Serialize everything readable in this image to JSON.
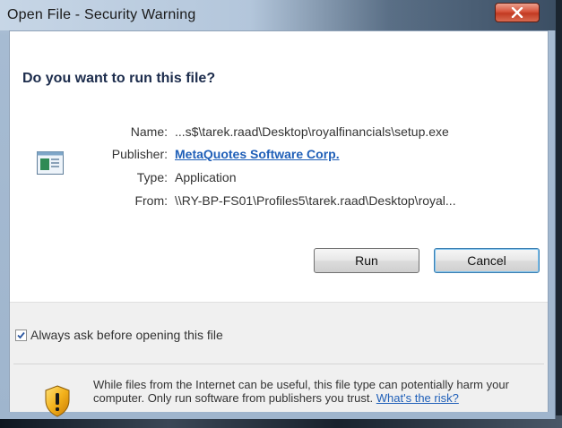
{
  "window": {
    "title": "Open File - Security Warning",
    "close_glyph": "X"
  },
  "dialog": {
    "heading": "Do you want to run this file?",
    "file_icon": "application-file-icon",
    "fields": {
      "name_label": "Name:",
      "name_value": "...s$\\tarek.raad\\Desktop\\royalfinancials\\setup.exe",
      "publisher_label": "Publisher:",
      "publisher_value": "MetaQuotes Software Corp.",
      "type_label": "Type:",
      "type_value": "Application",
      "from_label": "From:",
      "from_value": "\\\\RY-BP-FS01\\Profiles5\\tarek.raad\\Desktop\\royal..."
    },
    "buttons": {
      "run": "Run",
      "cancel": "Cancel"
    },
    "checkbox": {
      "label": "Always ask before opening this file",
      "checked": true
    },
    "warning": {
      "icon": "shield-warning-icon",
      "text": "While files from the Internet can be useful, this file type can potentially harm your computer. Only run software from publishers you trust.",
      "link": "What's the risk?"
    }
  },
  "colors": {
    "link": "#1f5fb8",
    "heading": "#1c2c4c",
    "close_button": "#c23a22",
    "footer_bg": "#f0f0f0"
  }
}
